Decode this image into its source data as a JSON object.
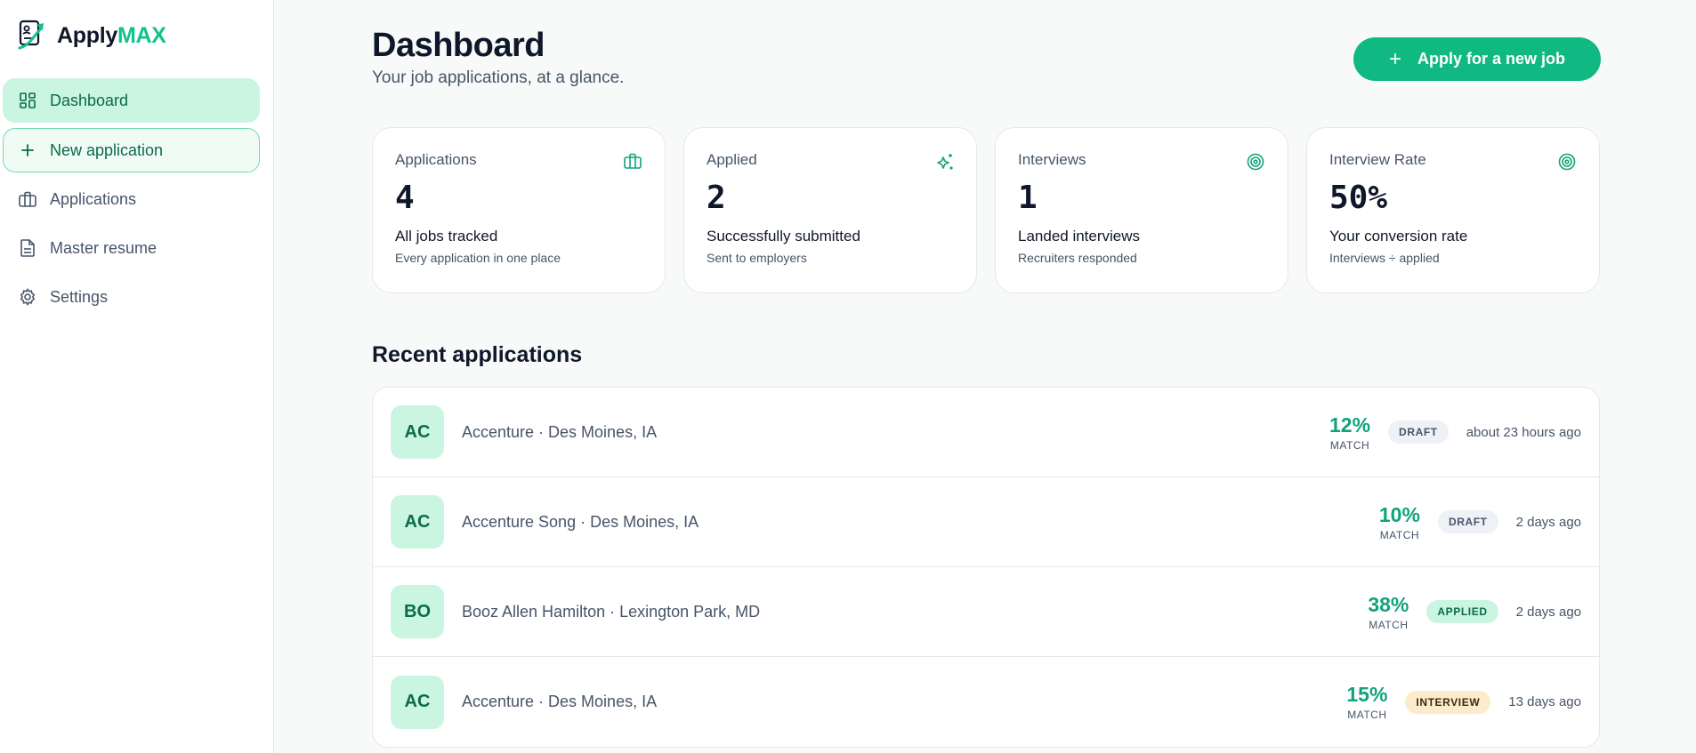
{
  "brand": {
    "name_a": "Apply",
    "name_b": "MAX",
    "accent": "#10b981"
  },
  "sidebar": {
    "items": [
      {
        "label": "Dashboard",
        "icon": "grid-icon",
        "state": "active"
      },
      {
        "label": "New application",
        "icon": "plus-icon",
        "state": "new"
      },
      {
        "label": "Applications",
        "icon": "briefcase-icon",
        "state": "plain"
      },
      {
        "label": "Master resume",
        "icon": "document-icon",
        "state": "plain"
      },
      {
        "label": "Settings",
        "icon": "gear-icon",
        "state": "plain"
      }
    ]
  },
  "header": {
    "title": "Dashboard",
    "subtitle": "Your job applications, at a glance.",
    "cta_icon": "+",
    "cta_label": "Apply for a new job"
  },
  "stats": [
    {
      "label": "Applications",
      "value": "4",
      "caption": "All jobs tracked",
      "sub": "Every application in one place",
      "icon": "briefcase-icon"
    },
    {
      "label": "Applied",
      "value": "2",
      "caption": "Successfully submitted",
      "sub": "Sent to employers",
      "icon": "sparkle-icon"
    },
    {
      "label": "Interviews",
      "value": "1",
      "caption": "Landed interviews",
      "sub": "Recruiters responded",
      "icon": "target-icon"
    },
    {
      "label": "Interview Rate",
      "value": "50%",
      "caption": "Your conversion rate",
      "sub": "Interviews ÷ applied",
      "icon": "target-icon"
    }
  ],
  "recent": {
    "title": "Recent applications",
    "match_label": "MATCH",
    "rows": [
      {
        "initials": "AC",
        "text": "Accenture · Des Moines, IA",
        "match": "12%",
        "status": "DRAFT",
        "status_kind": "draft",
        "time": "about 23 hours ago"
      },
      {
        "initials": "AC",
        "text": "Accenture Song · Des Moines, IA",
        "match": "10%",
        "status": "DRAFT",
        "status_kind": "draft",
        "time": "2 days ago"
      },
      {
        "initials": "BO",
        "text": "Booz Allen Hamilton · Lexington Park, MD",
        "match": "38%",
        "status": "APPLIED",
        "status_kind": "applied",
        "time": "2 days ago"
      },
      {
        "initials": "AC",
        "text": "Accenture · Des Moines, IA",
        "match": "15%",
        "status": "INTERVIEW",
        "status_kind": "interview",
        "time": "13 days ago"
      }
    ]
  }
}
